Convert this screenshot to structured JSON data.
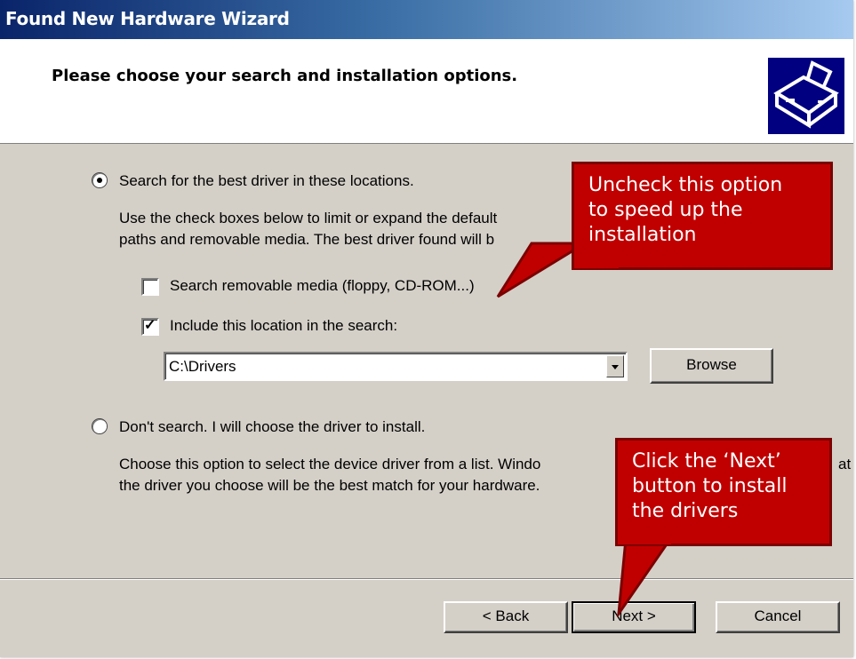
{
  "window": {
    "title": "Found New Hardware Wizard"
  },
  "header": {
    "heading": "Please choose your search and installation options."
  },
  "options": {
    "search_best": {
      "label": "Search for the best driver in these locations.",
      "selected": true,
      "description_line1": "Use the check boxes below to limit or expand the default",
      "description_line2": "paths and removable media. The best driver found will b"
    },
    "removable_media": {
      "label": "Search removable media (floppy, CD-ROM...)",
      "checked": false
    },
    "include_location": {
      "label": "Include this location in the search:",
      "checked": true,
      "path_value": "C:\\Drivers"
    },
    "browse_label": "Browse",
    "dont_search": {
      "label": "Don't search. I will choose the driver to install.",
      "selected": false,
      "description_line1": "Choose this option to select the device driver from a list.  Windo",
      "description_line1_tail": "at",
      "description_line2": "the driver you choose will be the best match for your hardware."
    }
  },
  "buttons": {
    "back": "< Back",
    "next": "Next >",
    "cancel": "Cancel"
  },
  "callouts": {
    "uncheck": {
      "lines": [
        "Uncheck this option",
        "to speed up the",
        "installation"
      ]
    },
    "next": {
      "lines": [
        "Click the ‘Next’",
        "button to install",
        "the drivers"
      ]
    }
  },
  "colors": {
    "dialog_bg": "#d4d0c8",
    "titlebar_start": "#0a246a",
    "titlebar_end": "#a6caf0",
    "callout_fill": "#c00000",
    "callout_border": "#7b0000"
  }
}
